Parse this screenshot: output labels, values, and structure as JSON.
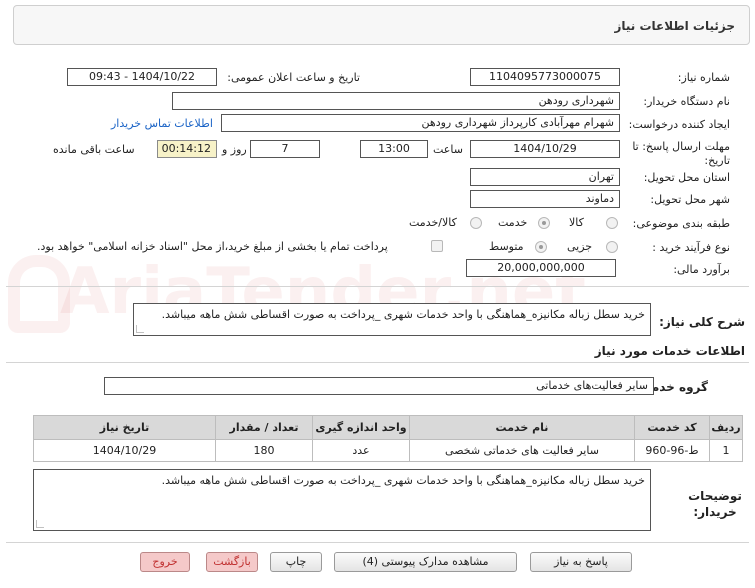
{
  "header": {
    "title": "جزئیات اطلاعات نیاز"
  },
  "watermark": "AriaTender.net",
  "form": {
    "need_number_label": "شماره نیاز:",
    "need_number": "1104095773000075",
    "announce_label": "تاریخ و ساعت اعلان عمومی:",
    "announce_value": "1404/10/22 - 09:43",
    "buyer_org_label": "نام دستگاه خریدار:",
    "buyer_org": "شهرداری رودهن",
    "creator_label": "ایجاد کننده درخواست:",
    "creator": "شهرام مهرآبادی کارپرداز شهرداری رودهن",
    "contact_link": "اطلاعات تماس خریدار",
    "deadline_label": "مهلت ارسال پاسخ: تا تاریخ:",
    "deadline_date": "1404/10/29",
    "time_label": "ساعت",
    "deadline_time": "13:00",
    "days_value": "7",
    "days_label": "روز و",
    "remaining_time": "00:14:12",
    "remaining_label": "ساعت باقی مانده",
    "province_label": "استان محل تحویل:",
    "province": "تهران",
    "city_label": "شهر محل تحویل:",
    "city": "دماوند",
    "category_label": "طبقه بندی موضوعی:",
    "category_options": [
      "کالا",
      "خدمت",
      "کالا/خدمت"
    ],
    "category_selected": "خدمت",
    "process_label": "نوع فرآیند خرید :",
    "process_options": [
      "جزیی",
      "متوسط"
    ],
    "process_selected": "متوسط",
    "payment_note": "پرداخت تمام یا بخشی از مبلغ خرید،از محل \"اسناد خزانه اسلامی\" خواهد بود.",
    "budget_label": "برآورد مالی:",
    "budget": "20,000,000,000"
  },
  "description": {
    "label": "شرح کلی نیاز:",
    "text": "خرید سطل زباله مکانیزه_هماهنگی با واحد خدمات شهری _پرداخت به صورت اقساطی شش ماهه میباشد."
  },
  "services": {
    "section_title": "اطلاعات خدمات مورد نیاز",
    "group_label": "گروه خدمت:",
    "group_value": "سایر فعالیت‌های خدماتی",
    "columns": [
      "ردیف",
      "کد خدمت",
      "نام خدمت",
      "واحد اندازه گیری",
      "تعداد / مقدار",
      "تاریخ نیاز"
    ],
    "rows": [
      [
        "1",
        "ط-96-960",
        "سایر فعالیت های خدماتی شخصی",
        "عدد",
        "180",
        "1404/10/29"
      ]
    ]
  },
  "buyer_notes": {
    "label": "توضیحات خریدار:",
    "text": "خرید سطل زباله مکانیزه_هماهنگی با واحد خدمات شهری _پرداخت به صورت اقساطی شش ماهه میباشد."
  },
  "buttons": {
    "reply": "پاسخ به نیاز",
    "view_docs": "مشاهده مدارک پیوستی (4)",
    "print": "چاپ",
    "back": "بازگشت",
    "exit": "خروج"
  }
}
